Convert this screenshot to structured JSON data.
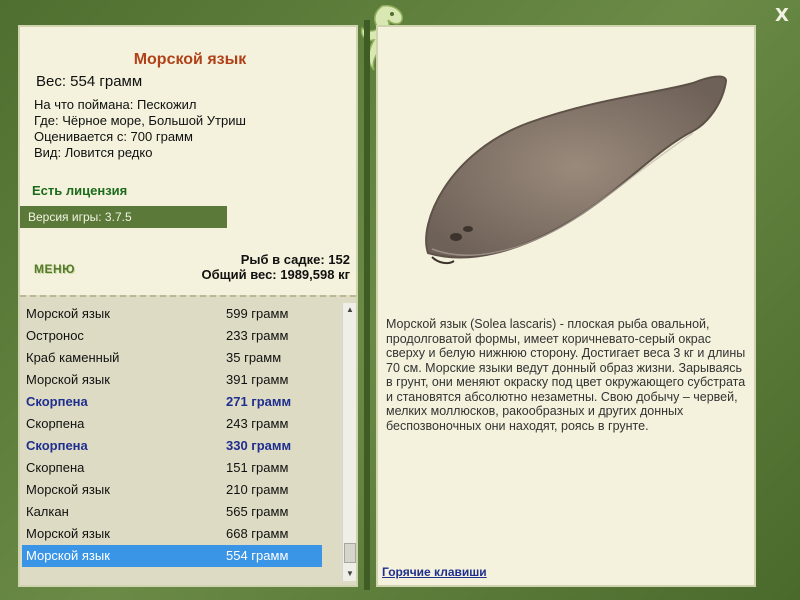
{
  "fish": {
    "title": "Морской язык",
    "weight": "Вес: 554 грамм",
    "caught_on": "На что поймана: Пескожил",
    "location": "Где: Чёрное море, Большой Утриш",
    "valued": "Оценивается с: 700 грамм",
    "rarity": "Вид: Ловится редко"
  },
  "license": "Есть лицензия",
  "version": "Версия игры: 3.7.5",
  "menu_label": "МЕНЮ",
  "cage": {
    "count": "Рыб в садке: 152",
    "total": "Общий вес: 1989,598 кг"
  },
  "catch_list": [
    {
      "name": "Морской язык",
      "weight": "599 грамм",
      "style": ""
    },
    {
      "name": "Остронос",
      "weight": "233 грамм",
      "style": ""
    },
    {
      "name": "Краб каменный",
      "weight": "35 грамм",
      "style": ""
    },
    {
      "name": "Морской язык",
      "weight": "391 грамм",
      "style": ""
    },
    {
      "name": "Скорпена",
      "weight": "271 грамм",
      "style": "bold"
    },
    {
      "name": "Скорпена",
      "weight": "243 грамм",
      "style": ""
    },
    {
      "name": "Скорпена",
      "weight": "330 грамм",
      "style": "bold"
    },
    {
      "name": "Скорпена",
      "weight": "151 грамм",
      "style": ""
    },
    {
      "name": "Морской язык",
      "weight": "210 грамм",
      "style": ""
    },
    {
      "name": "Калкан",
      "weight": "565 грамм",
      "style": ""
    },
    {
      "name": "Морской язык",
      "weight": "668 грамм",
      "style": ""
    },
    {
      "name": "Морской язык",
      "weight": "554 грамм",
      "style": "sel"
    }
  ],
  "description": "Морской язык (Solea lascaris) - плоская рыба овальной, продолговатой формы, имеет коричневато-серый окрас сверху и белую нижнюю сторону. Достигает веса 3 кг и длины 70 см. Морские языки ведут донный образ жизни. Зарываясь в грунт, они меняют окраску под цвет окружающего субстрата и становятся абсолютно незаметны. Свою добычу – червей, мелких моллюсков, ракообразных и других донных беспозвоночных они находят, роясь в грунте.",
  "hotkeys_label": "Горячие клавиши",
  "close_symbol": "X",
  "icons": [
    "logo-fish-icon",
    "close-icon",
    "scroll-up-icon",
    "scroll-down-icon",
    "fish-picture"
  ]
}
